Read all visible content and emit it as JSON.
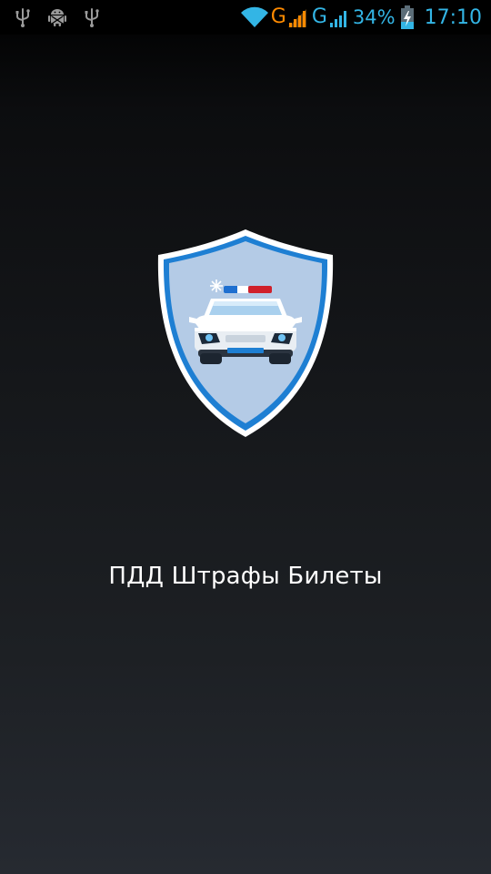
{
  "status_bar": {
    "left_icons": [
      "usb-icon",
      "android-debug-icon",
      "usb-icon"
    ],
    "wifi_icon": "wifi-icon",
    "network_1": {
      "type": "G",
      "color": "#ff8a00",
      "signal_color": "#ff8a00"
    },
    "network_2": {
      "type": "G",
      "color": "#33b5e5",
      "signal_color": "#33b5e5"
    },
    "battery_percent": "34%",
    "battery_level": 0.34,
    "battery_charging": true,
    "time": "17:10",
    "accent_color": "#33b5e5"
  },
  "splash": {
    "logo_icon": "police-car-shield-icon",
    "app_title": "ПДД Штрафы Билеты"
  },
  "colors": {
    "shield_outer": "#ffffff",
    "shield_border": "#1e7fd3",
    "shield_fill": "#b4cbe6",
    "title_text": "#ffffff"
  }
}
